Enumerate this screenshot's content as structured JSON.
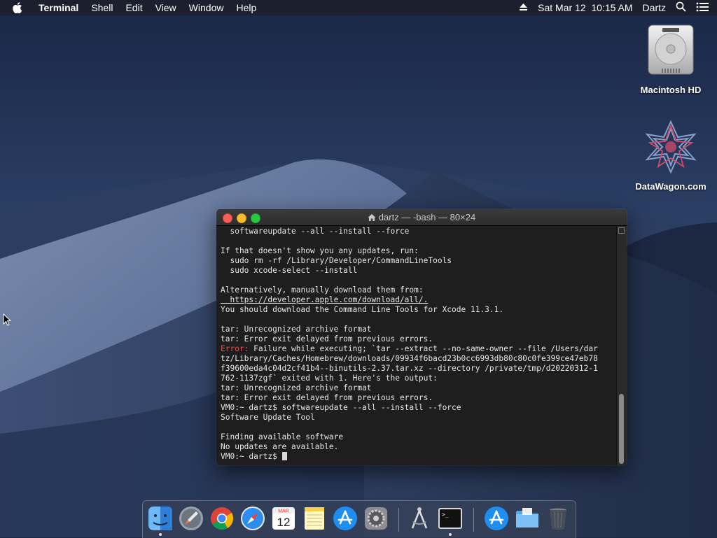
{
  "menubar": {
    "app_name": "Terminal",
    "menus": [
      "Shell",
      "Edit",
      "View",
      "Window",
      "Help"
    ],
    "datetime": "Sat Mar 12  10:15 AM",
    "user": "Dartz"
  },
  "desktop": {
    "icons": [
      {
        "label": "Macintosh HD",
        "icon": "hard-drive-icon"
      },
      {
        "label": "DataWagon.com",
        "icon": "datawagon-logo-icon"
      }
    ]
  },
  "terminal": {
    "title": "dartz — -bash — 80×24",
    "lines": [
      {
        "text": "  softwareupdate --all --install --force"
      },
      {
        "text": ""
      },
      {
        "text": "If that doesn't show you any updates, run:"
      },
      {
        "text": "  sudo rm -rf /Library/Developer/CommandLineTools"
      },
      {
        "text": "  sudo xcode-select --install"
      },
      {
        "text": ""
      },
      {
        "text": "Alternatively, manually download them from:"
      },
      {
        "text": "  https://developer.apple.com/download/all/."
      },
      {
        "text": "You should download the Command Line Tools for Xcode 11.3.1."
      },
      {
        "text": ""
      },
      {
        "text": "tar: Unrecognized archive format"
      },
      {
        "text": "tar: Error exit delayed from previous errors."
      },
      {
        "prefix": "Error:",
        "text": " Failure while executing; `tar --extract --no-same-owner --file /Users/dar"
      },
      {
        "text": "tz/Library/Caches/Homebrew/downloads/09934f6bacd23b0cc6993db80c80c0fe399ce47eb78"
      },
      {
        "text": "f39600eda4c04d2cf41b4--binutils-2.37.tar.xz --directory /private/tmp/d20220312-1"
      },
      {
        "text": "762-1137zgf` exited with 1. Here's the output:"
      },
      {
        "text": "tar: Unrecognized archive format"
      },
      {
        "text": "tar: Error exit delayed from previous errors."
      },
      {
        "text": "VM0:~ dartz$ softwareupdate --all --install --force"
      },
      {
        "text": "Software Update Tool"
      },
      {
        "text": ""
      },
      {
        "text": "Finding available software"
      },
      {
        "text": "No updates are available."
      }
    ],
    "prompt": "VM0:~ dartz$ "
  },
  "dock": {
    "items": [
      {
        "name": "Finder",
        "icon": "finder-icon",
        "running": true
      },
      {
        "name": "Launchpad",
        "icon": "launchpad-icon",
        "running": false
      },
      {
        "name": "Google Chrome",
        "icon": "chrome-icon",
        "running": false
      },
      {
        "name": "Safari",
        "icon": "safari-icon",
        "running": false
      },
      {
        "name": "Calendar",
        "icon": "calendar-icon",
        "running": false,
        "month": "MAR",
        "day": "12"
      },
      {
        "name": "Notes",
        "icon": "notes-icon",
        "running": false
      },
      {
        "name": "App Store",
        "icon": "app-store-icon",
        "running": false
      },
      {
        "name": "System Preferences",
        "icon": "system-preferences-icon",
        "running": false
      },
      {
        "name": "Utility",
        "icon": "compass-icon",
        "running": false
      },
      {
        "name": "Terminal",
        "icon": "terminal-icon",
        "running": true
      },
      {
        "name": "App Store Downloads",
        "icon": "app-store-icon",
        "running": false
      },
      {
        "name": "Applications",
        "icon": "folder-icon",
        "running": false
      },
      {
        "name": "Trash",
        "icon": "trash-icon",
        "running": false
      }
    ]
  }
}
